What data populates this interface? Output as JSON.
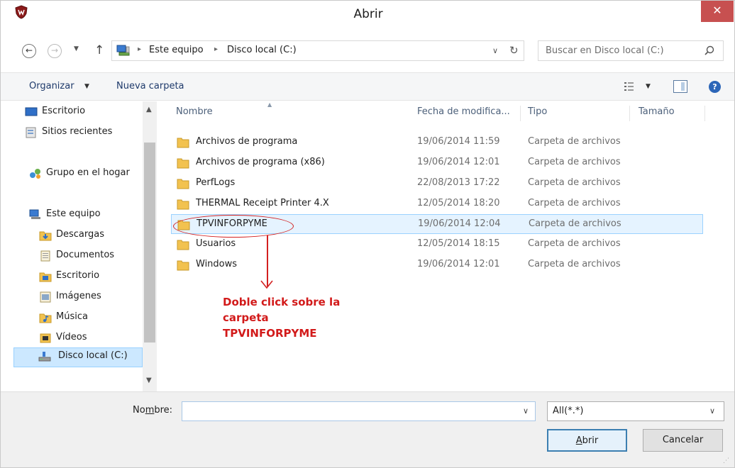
{
  "window": {
    "title": "Abrir",
    "close_glyph": "✕"
  },
  "address": {
    "segments": [
      "Este equipo",
      "Disco local (C:)"
    ],
    "search_placeholder": "Buscar en Disco local (C:)"
  },
  "toolbar": {
    "organize_label": "Organizar",
    "new_folder_label": "Nueva carpeta"
  },
  "nav_pane": {
    "items": [
      {
        "label": "Escritorio",
        "icon": "desktop-icon"
      },
      {
        "label": "Sitios recientes",
        "icon": "recent-places-icon"
      },
      {
        "label": "Grupo en el hogar",
        "icon": "homegroup-icon"
      },
      {
        "label": "Este equipo",
        "icon": "computer-icon"
      },
      {
        "label": "Descargas",
        "icon": "downloads-icon"
      },
      {
        "label": "Documentos",
        "icon": "documents-icon"
      },
      {
        "label": "Escritorio",
        "icon": "desktop-folder-icon"
      },
      {
        "label": "Imágenes",
        "icon": "pictures-icon"
      },
      {
        "label": "Música",
        "icon": "music-icon"
      },
      {
        "label": "Vídeos",
        "icon": "videos-icon"
      },
      {
        "label": "Disco local (C:)",
        "icon": "local-disk-icon",
        "selected": true
      }
    ]
  },
  "file_list": {
    "columns": [
      "Nombre",
      "Fecha de modifica...",
      "Tipo",
      "Tamaño"
    ],
    "rows": [
      {
        "name": "Archivos de programa",
        "date": "19/06/2014 11:59",
        "type": "Carpeta de archivos"
      },
      {
        "name": "Archivos de programa (x86)",
        "date": "19/06/2014 12:01",
        "type": "Carpeta de archivos"
      },
      {
        "name": "PerfLogs",
        "date": "22/08/2013 17:22",
        "type": "Carpeta de archivos"
      },
      {
        "name": "THERMAL Receipt Printer 4.X",
        "date": "12/05/2014 18:20",
        "type": "Carpeta de archivos"
      },
      {
        "name": "TPVINFORPYME",
        "date": "19/06/2014 12:04",
        "type": "Carpeta de archivos",
        "selected": true
      },
      {
        "name": "Usuarios",
        "date": "12/05/2014 18:15",
        "type": "Carpeta de archivos"
      },
      {
        "name": "Windows",
        "date": "19/06/2014 12:01",
        "type": "Carpeta de archivos"
      }
    ]
  },
  "annotation": {
    "lines": [
      "Doble click sobre la",
      "carpeta",
      "TPVINFORPYME"
    ],
    "color": "#d21a1a"
  },
  "bottom": {
    "filename_label_pre": "No",
    "filename_label_underlined": "m",
    "filename_label_post": "bre:",
    "filename_value": "",
    "filter_value": "All(*.*)",
    "open_label_underlined": "A",
    "open_label_rest": "brir",
    "cancel_label": "Cancelar"
  },
  "colors": {
    "accent": "#3c7fb1",
    "selection": "#e5f3ff",
    "close": "#c75050"
  }
}
